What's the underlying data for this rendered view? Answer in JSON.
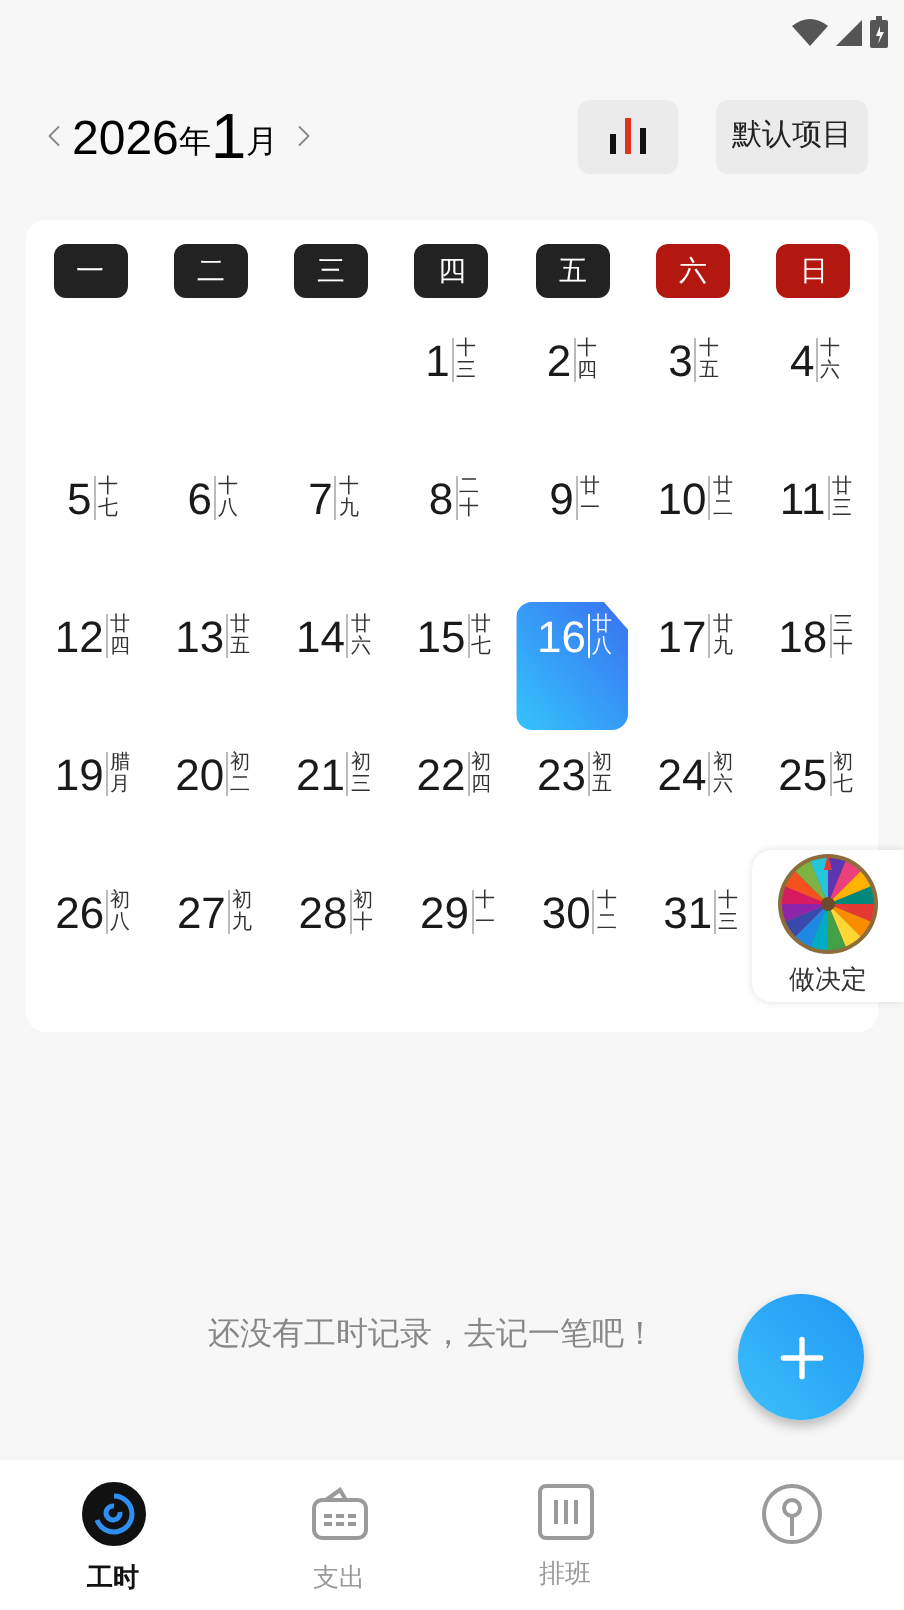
{
  "header": {
    "year": "2026",
    "year_unit": "年",
    "month": "1",
    "month_unit": "月",
    "project_button": "默认项目"
  },
  "weekdays": [
    {
      "label": "一",
      "weekend": false
    },
    {
      "label": "二",
      "weekend": false
    },
    {
      "label": "三",
      "weekend": false
    },
    {
      "label": "四",
      "weekend": false
    },
    {
      "label": "五",
      "weekend": false
    },
    {
      "label": "六",
      "weekend": true
    },
    {
      "label": "日",
      "weekend": true
    }
  ],
  "weeks": [
    [
      {
        "day": "1",
        "lunar": "十三",
        "selected": false
      },
      {
        "day": "2",
        "lunar": "十四",
        "selected": false
      },
      {
        "day": "3",
        "lunar": "十五",
        "selected": false
      },
      {
        "day": "4",
        "lunar": "十六",
        "selected": false
      }
    ],
    [
      {
        "day": "5",
        "lunar": "十七",
        "selected": false
      },
      {
        "day": "6",
        "lunar": "十八",
        "selected": false
      },
      {
        "day": "7",
        "lunar": "十九",
        "selected": false
      },
      {
        "day": "8",
        "lunar": "二十",
        "selected": false
      },
      {
        "day": "9",
        "lunar": "廿一",
        "selected": false
      },
      {
        "day": "10",
        "lunar": "廿二",
        "selected": false
      },
      {
        "day": "11",
        "lunar": "廿三",
        "selected": false
      }
    ],
    [
      {
        "day": "12",
        "lunar": "廿四",
        "selected": false
      },
      {
        "day": "13",
        "lunar": "廿五",
        "selected": false
      },
      {
        "day": "14",
        "lunar": "廿六",
        "selected": false
      },
      {
        "day": "15",
        "lunar": "廿七",
        "selected": false
      },
      {
        "day": "16",
        "lunar": "廿八",
        "selected": true
      },
      {
        "day": "17",
        "lunar": "廿九",
        "selected": false
      },
      {
        "day": "18",
        "lunar": "三十",
        "selected": false
      }
    ],
    [
      {
        "day": "19",
        "lunar": "腊月",
        "selected": false
      },
      {
        "day": "20",
        "lunar": "初二",
        "selected": false
      },
      {
        "day": "21",
        "lunar": "初三",
        "selected": false
      },
      {
        "day": "22",
        "lunar": "初四",
        "selected": false
      },
      {
        "day": "23",
        "lunar": "初五",
        "selected": false
      },
      {
        "day": "24",
        "lunar": "初六",
        "selected": false
      },
      {
        "day": "25",
        "lunar": "初七",
        "selected": false
      }
    ],
    [
      {
        "day": "26",
        "lunar": "初八",
        "selected": false
      },
      {
        "day": "27",
        "lunar": "初九",
        "selected": false
      },
      {
        "day": "28",
        "lunar": "初十",
        "selected": false
      },
      {
        "day": "29",
        "lunar": "十一",
        "selected": false
      },
      {
        "day": "30",
        "lunar": "十二",
        "selected": false
      },
      {
        "day": "31",
        "lunar": "十三",
        "selected": false
      }
    ]
  ],
  "decide_widget": {
    "label": "做决定"
  },
  "empty_message": "还没有工时记录，去记一笔吧！",
  "nav": [
    {
      "label": "工时",
      "kind": "clock",
      "selected": true
    },
    {
      "label": "支出",
      "kind": "wallet",
      "selected": false
    },
    {
      "label": "排班",
      "kind": "schedule",
      "selected": false
    },
    {
      "kind": "person",
      "selected": false
    }
  ]
}
